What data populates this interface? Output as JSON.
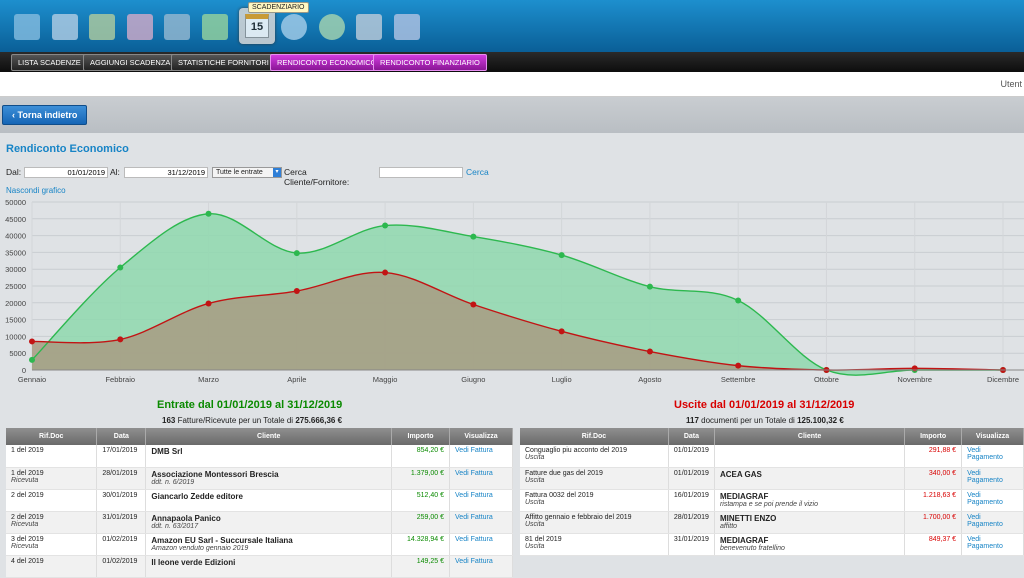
{
  "toolbar": {
    "active_tooltip": "SCADENZIARIO",
    "calendar_day": "15"
  },
  "subnav": [
    "LISTA SCADENZE",
    "AGGIUNGI SCADENZA",
    "STATISTICHE FORNITORI",
    "RENDICONTO ECONOMICO",
    "RENDICONTO FINANZIARIO"
  ],
  "user_label": "Utent",
  "back_label": "Torna indietro",
  "page_title": "Rendiconto Economico",
  "filters": {
    "dal_label": "Dal:",
    "dal_value": "01/01/2019",
    "al_label": "Al:",
    "al_value": "31/12/2019",
    "type_select": "Tutte le entrate",
    "search_label": "Cerca Cliente/Fornitore:",
    "search_value": "",
    "search_button": "Cerca"
  },
  "hide_chart_label": "Nascondi grafico",
  "chart_data": {
    "type": "area",
    "categories": [
      "Gennaio",
      "Febbraio",
      "Marzo",
      "Aprile",
      "Maggio",
      "Giugno",
      "Luglio",
      "Agosto",
      "Settembre",
      "Ottobre",
      "Novembre",
      "Dicembre"
    ],
    "series": [
      {
        "values": [
          3000,
          30500,
          46500,
          34800,
          43000,
          39700,
          34200,
          24800,
          20700,
          0,
          0,
          0
        ],
        "color": "#2db84f",
        "fill": "#8fd8ae"
      },
      {
        "values": [
          8500,
          9100,
          19800,
          23500,
          29000,
          19500,
          11500,
          5500,
          1300,
          0,
          500,
          0
        ],
        "color": "#c21414",
        "fill": "#a89b82"
      }
    ],
    "ylim": [
      0,
      50000
    ],
    "yticks": [
      0,
      5000,
      10000,
      15000,
      20000,
      25000,
      30000,
      35000,
      40000,
      45000,
      50000
    ],
    "grid": true
  },
  "entrate": {
    "title": "Entrate dal 01/01/2019 al 31/12/2019",
    "summary_count": "163",
    "summary_text": "Fatture/Ricevute per un Totale di",
    "summary_total": "275.666,36 €",
    "headers": [
      "Rif.Doc",
      "Data",
      "Cliente",
      "Importo",
      "Visualizza"
    ],
    "rows": [
      {
        "rif": "1 del 2019",
        "rif_sub": "",
        "data": "17/01/2019",
        "cliente": "DMB Srl",
        "cliente_sub": "",
        "importo": "854,20 €",
        "azione": "Vedi Fattura"
      },
      {
        "rif": "1 del 2019",
        "rif_sub": "Ricevuta",
        "data": "28/01/2019",
        "cliente": "Associazione Montessori Brescia",
        "cliente_sub": "ddt. n. 6/2019",
        "importo": "1.379,00 €",
        "azione": "Vedi Fattura"
      },
      {
        "rif": "2 del 2019",
        "rif_sub": "",
        "data": "30/01/2019",
        "cliente": "Giancarlo Zedde editore",
        "cliente_sub": "",
        "importo": "512,40 €",
        "azione": "Vedi Fattura"
      },
      {
        "rif": "2 del 2019",
        "rif_sub": "Ricevuta",
        "data": "31/01/2019",
        "cliente": "Annapaola Panico",
        "cliente_sub": "ddt. n. 63/2017",
        "importo": "259,00 €",
        "azione": "Vedi Fattura"
      },
      {
        "rif": "3 del 2019",
        "rif_sub": "Ricevuta",
        "data": "01/02/2019",
        "cliente": "Amazon EU Sarl - Succursale Italiana",
        "cliente_sub": "Amazon venduto gennaio 2019",
        "importo": "14.328,94 €",
        "azione": "Vedi Fattura"
      },
      {
        "rif": "4 del 2019",
        "rif_sub": "",
        "data": "01/02/2019",
        "cliente": "Il leone verde Edizioni",
        "cliente_sub": "",
        "importo": "149,25 €",
        "azione": "Vedi Fattura"
      }
    ]
  },
  "uscite": {
    "title": "Uscite dal 01/01/2019 al 31/12/2019",
    "summary_count": "117",
    "summary_text": "documenti per un Totale di",
    "summary_total": "125.100,32 €",
    "headers": [
      "Rif.Doc",
      "Data",
      "Cliente",
      "Importo",
      "Visualizza"
    ],
    "rows": [
      {
        "rif": "Conguaglio piu acconto del 2019",
        "rif_sub": "Uscita",
        "data": "01/01/2019",
        "cliente": "",
        "cliente_sub": "",
        "importo": "291,88 €",
        "azione": "Vedi Pagamento"
      },
      {
        "rif": "Fatture due gas del 2019",
        "rif_sub": "Uscita",
        "data": "01/01/2019",
        "cliente": "ACEA GAS",
        "cliente_sub": "",
        "importo": "340,00 €",
        "azione": "Vedi Pagamento"
      },
      {
        "rif": "Fattura 0032 del 2019",
        "rif_sub": "Uscita",
        "data": "16/01/2019",
        "cliente": "MEDIAGRAF",
        "cliente_sub": "ristampa e se poi prende il vizio",
        "importo": "1.218,63 €",
        "azione": "Vedi Pagamento"
      },
      {
        "rif": "Affitto gennaio e febbraio del 2019",
        "rif_sub": "Uscita",
        "data": "28/01/2019",
        "cliente": "MINETTI ENZO",
        "cliente_sub": "affitto",
        "importo": "1.700,00 €",
        "azione": "Vedi Pagamento"
      },
      {
        "rif": "81 del 2019",
        "rif_sub": "Uscita",
        "data": "31/01/2019",
        "cliente": "MEDIAGRAF",
        "cliente_sub": "benevenuto fratellino",
        "importo": "849,37 €",
        "azione": "Vedi Pagamento"
      }
    ]
  }
}
